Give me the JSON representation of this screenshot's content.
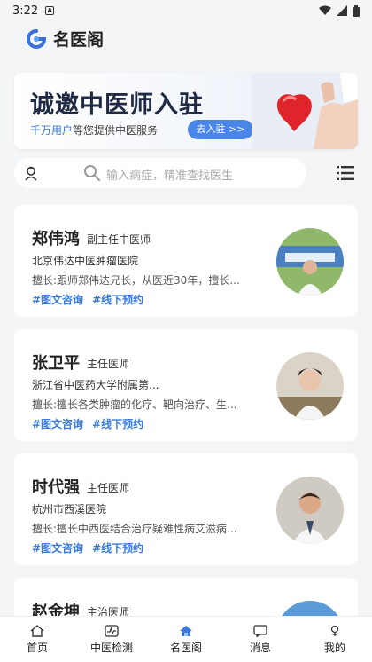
{
  "status_bar": {
    "time": "3:22",
    "notif_glyph": "A"
  },
  "header": {
    "app_title": "名医阁",
    "logo_color": "#3a6fd8"
  },
  "banner": {
    "headline": "诚邀中医师入驻",
    "sub_highlight": "千万用户",
    "sub_rest": "等您提供中医服务",
    "join_label": "去入驻 >>"
  },
  "search": {
    "placeholder": "输入病症，精准查找医生"
  },
  "doctors": [
    {
      "name": "郑伟鸿",
      "title": "副主任中医师",
      "hospital": "北京伟达中医肿瘤医院",
      "skill": "擅长:跟师郑伟达兄长，从医近30年，擅长...",
      "tag1": "#图文咨询",
      "tag2": "#线下预约"
    },
    {
      "name": "张卫平",
      "title": "主任医师",
      "hospital": "浙江省中医药大学附属第...",
      "skill": "擅长:擅长各类肿瘤的化疗、靶向治疗、生...",
      "tag1": "#图文咨询",
      "tag2": "#线下预约"
    },
    {
      "name": "时代强",
      "title": "主任医师",
      "hospital": "杭州市西溪医院",
      "skill": "擅长:擅长中西医结合治疗疑难性病艾滋病...",
      "tag1": "#图文咨询",
      "tag2": "#线下预约"
    },
    {
      "name": "赵金坤",
      "title": "主治医师"
    }
  ],
  "tabs": [
    {
      "label": "首页",
      "icon": "home-outline-icon"
    },
    {
      "label": "中医检测",
      "icon": "pulse-icon"
    },
    {
      "label": "名医阁",
      "icon": "home-filled-icon",
      "active": true
    },
    {
      "label": "消息",
      "icon": "message-icon"
    },
    {
      "label": "我的",
      "icon": "profile-icon"
    }
  ],
  "colors": {
    "accent": "#3a7be0",
    "button": "#4a86e8"
  }
}
